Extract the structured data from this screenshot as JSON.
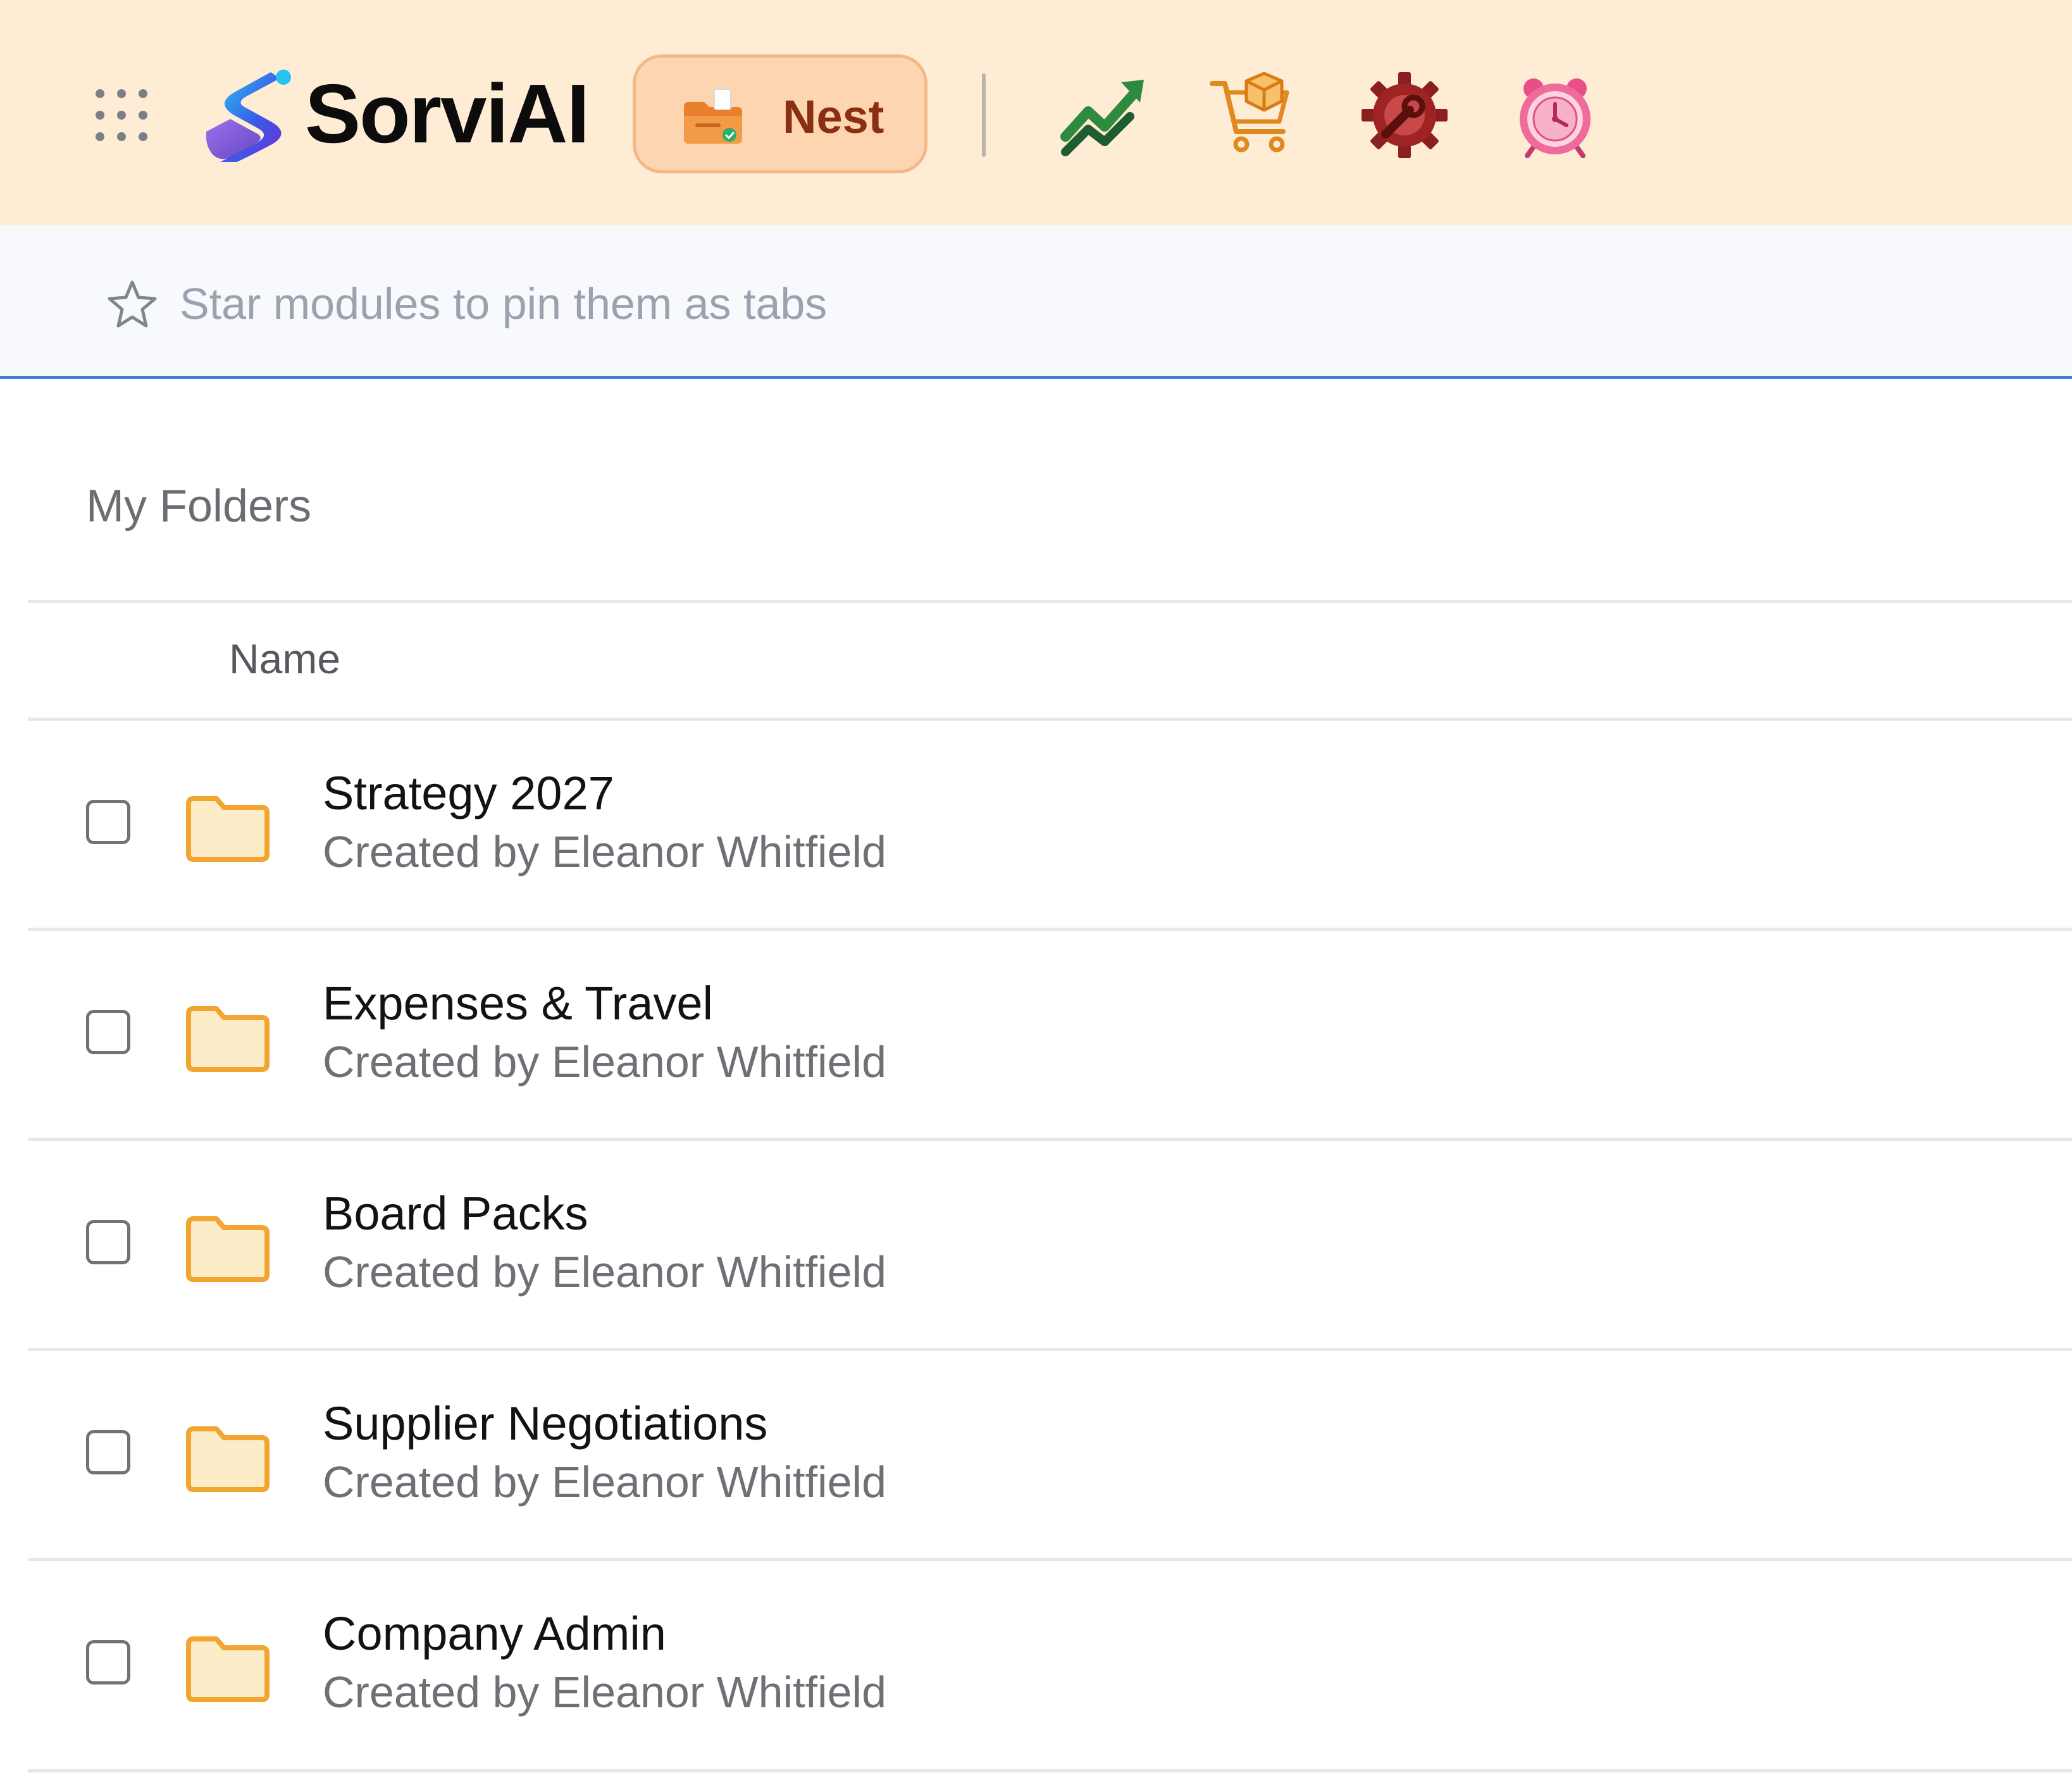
{
  "app": {
    "brand_name": "SorviAI",
    "active_module_label": "Nest",
    "module_icons": [
      "growth-chart-icon",
      "shopping-cart-icon",
      "gear-wrench-icon",
      "alarm-clock-icon"
    ]
  },
  "pinbar": {
    "hint": "Star modules to pin them as tabs"
  },
  "content": {
    "section_title": "My Folders",
    "column_name": "Name",
    "folders": [
      {
        "name": "Strategy 2027",
        "meta": "Created by Eleanor Whitfield",
        "checked": false
      },
      {
        "name": "Expenses & Travel",
        "meta": "Created by Eleanor Whitfield",
        "checked": false
      },
      {
        "name": "Board Packs",
        "meta": "Created by Eleanor Whitfield",
        "checked": false
      },
      {
        "name": "Supplier Negotiations",
        "meta": "Created by Eleanor Whitfield",
        "checked": false
      },
      {
        "name": "Company Admin",
        "meta": "Created by Eleanor Whitfield",
        "checked": false
      }
    ]
  },
  "colors": {
    "topbar_bg": "#feecd5",
    "accent_blue": "#3f7fdc",
    "nest_button_bg": "#fdd6b1",
    "folder_stroke": "#f2a531",
    "folder_fill": "#fdecc8"
  }
}
